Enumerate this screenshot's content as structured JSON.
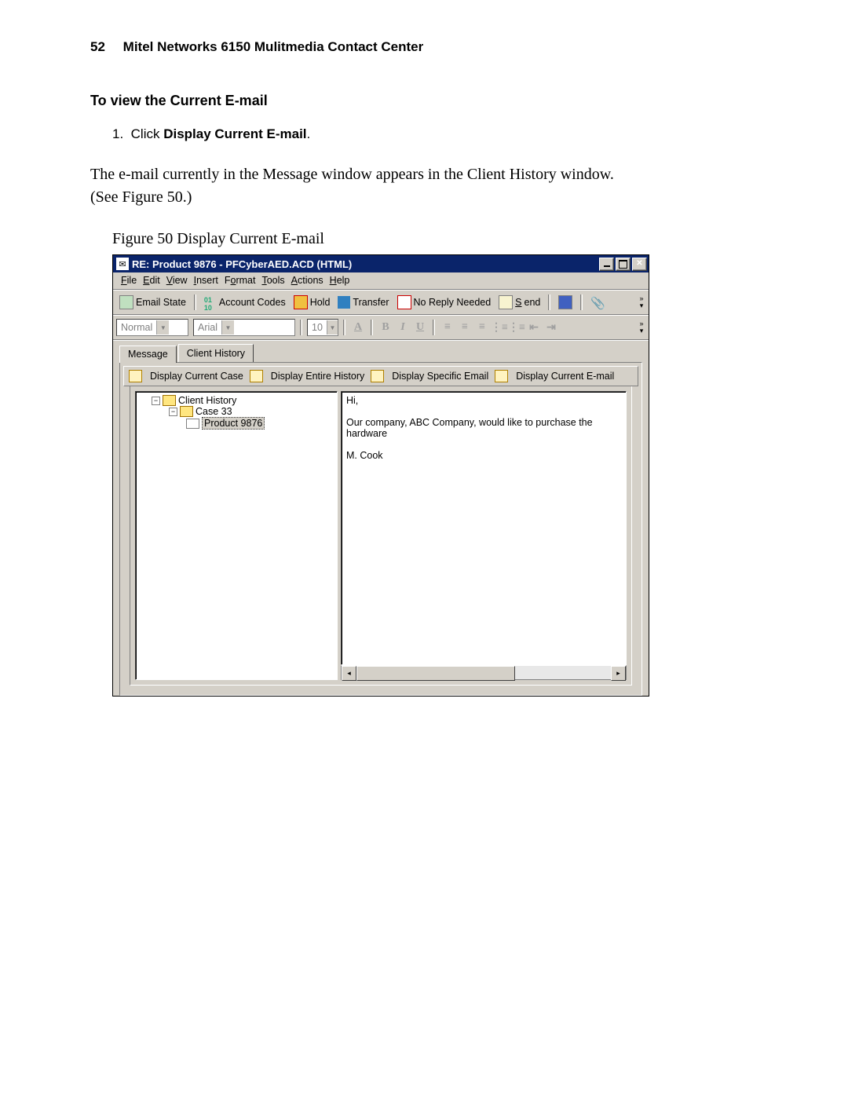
{
  "header": {
    "page_num": "52",
    "title": "Mitel Networks 6150 Mulitmedia Contact Center"
  },
  "section_title": "To view the Current E-mail",
  "step": {
    "num": "1.",
    "pre": "Click ",
    "bold": "Display Current E-mail",
    "post": "."
  },
  "body1": "The e-mail currently in the Message window appears in the Client History window.",
  "body2": "(See Figure 50.)",
  "figure_caption": "Figure 50  Display Current E-mail",
  "window": {
    "title": "RE: Product 9876 - PFCyberAED.ACD  (HTML)",
    "menu": [
      "File",
      "Edit",
      "View",
      "Insert",
      "Format",
      "Tools",
      "Actions",
      "Help"
    ],
    "toolbar1": {
      "email_state": "Email State",
      "account_codes": "Account Codes",
      "hold": "Hold",
      "transfer": "Transfer",
      "no_reply": "No Reply Needed",
      "send": "Send"
    },
    "format_row": {
      "style": "Normal",
      "font": "Arial",
      "size": "10"
    },
    "tabs": {
      "message": "Message",
      "history": "Client History"
    },
    "subtoolbar": {
      "current_case": "Display Current Case",
      "entire_history": "Display Entire History",
      "specific_email": "Display Specific Email",
      "current_email": "Display Current E-mail"
    },
    "tree": {
      "root": "Client History",
      "case": "Case 33",
      "product": "Product 9876"
    },
    "message": {
      "l1": "Hi,",
      "l2": "Our company, ABC Company, would like to purchase the hardware",
      "l3": "M. Cook"
    }
  }
}
